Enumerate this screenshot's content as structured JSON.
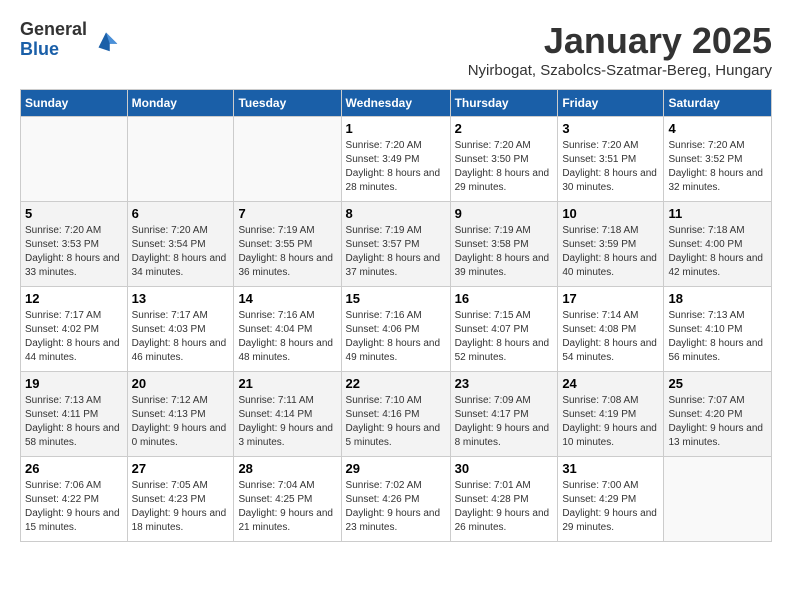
{
  "logo": {
    "general": "General",
    "blue": "Blue"
  },
  "title": "January 2025",
  "subtitle": "Nyirbogat, Szabolcs-Szatmar-Bereg, Hungary",
  "days_header": [
    "Sunday",
    "Monday",
    "Tuesday",
    "Wednesday",
    "Thursday",
    "Friday",
    "Saturday"
  ],
  "weeks": [
    [
      {
        "num": "",
        "info": ""
      },
      {
        "num": "",
        "info": ""
      },
      {
        "num": "",
        "info": ""
      },
      {
        "num": "1",
        "info": "Sunrise: 7:20 AM\nSunset: 3:49 PM\nDaylight: 8 hours and 28 minutes."
      },
      {
        "num": "2",
        "info": "Sunrise: 7:20 AM\nSunset: 3:50 PM\nDaylight: 8 hours and 29 minutes."
      },
      {
        "num": "3",
        "info": "Sunrise: 7:20 AM\nSunset: 3:51 PM\nDaylight: 8 hours and 30 minutes."
      },
      {
        "num": "4",
        "info": "Sunrise: 7:20 AM\nSunset: 3:52 PM\nDaylight: 8 hours and 32 minutes."
      }
    ],
    [
      {
        "num": "5",
        "info": "Sunrise: 7:20 AM\nSunset: 3:53 PM\nDaylight: 8 hours and 33 minutes."
      },
      {
        "num": "6",
        "info": "Sunrise: 7:20 AM\nSunset: 3:54 PM\nDaylight: 8 hours and 34 minutes."
      },
      {
        "num": "7",
        "info": "Sunrise: 7:19 AM\nSunset: 3:55 PM\nDaylight: 8 hours and 36 minutes."
      },
      {
        "num": "8",
        "info": "Sunrise: 7:19 AM\nSunset: 3:57 PM\nDaylight: 8 hours and 37 minutes."
      },
      {
        "num": "9",
        "info": "Sunrise: 7:19 AM\nSunset: 3:58 PM\nDaylight: 8 hours and 39 minutes."
      },
      {
        "num": "10",
        "info": "Sunrise: 7:18 AM\nSunset: 3:59 PM\nDaylight: 8 hours and 40 minutes."
      },
      {
        "num": "11",
        "info": "Sunrise: 7:18 AM\nSunset: 4:00 PM\nDaylight: 8 hours and 42 minutes."
      }
    ],
    [
      {
        "num": "12",
        "info": "Sunrise: 7:17 AM\nSunset: 4:02 PM\nDaylight: 8 hours and 44 minutes."
      },
      {
        "num": "13",
        "info": "Sunrise: 7:17 AM\nSunset: 4:03 PM\nDaylight: 8 hours and 46 minutes."
      },
      {
        "num": "14",
        "info": "Sunrise: 7:16 AM\nSunset: 4:04 PM\nDaylight: 8 hours and 48 minutes."
      },
      {
        "num": "15",
        "info": "Sunrise: 7:16 AM\nSunset: 4:06 PM\nDaylight: 8 hours and 49 minutes."
      },
      {
        "num": "16",
        "info": "Sunrise: 7:15 AM\nSunset: 4:07 PM\nDaylight: 8 hours and 52 minutes."
      },
      {
        "num": "17",
        "info": "Sunrise: 7:14 AM\nSunset: 4:08 PM\nDaylight: 8 hours and 54 minutes."
      },
      {
        "num": "18",
        "info": "Sunrise: 7:13 AM\nSunset: 4:10 PM\nDaylight: 8 hours and 56 minutes."
      }
    ],
    [
      {
        "num": "19",
        "info": "Sunrise: 7:13 AM\nSunset: 4:11 PM\nDaylight: 8 hours and 58 minutes."
      },
      {
        "num": "20",
        "info": "Sunrise: 7:12 AM\nSunset: 4:13 PM\nDaylight: 9 hours and 0 minutes."
      },
      {
        "num": "21",
        "info": "Sunrise: 7:11 AM\nSunset: 4:14 PM\nDaylight: 9 hours and 3 minutes."
      },
      {
        "num": "22",
        "info": "Sunrise: 7:10 AM\nSunset: 4:16 PM\nDaylight: 9 hours and 5 minutes."
      },
      {
        "num": "23",
        "info": "Sunrise: 7:09 AM\nSunset: 4:17 PM\nDaylight: 9 hours and 8 minutes."
      },
      {
        "num": "24",
        "info": "Sunrise: 7:08 AM\nSunset: 4:19 PM\nDaylight: 9 hours and 10 minutes."
      },
      {
        "num": "25",
        "info": "Sunrise: 7:07 AM\nSunset: 4:20 PM\nDaylight: 9 hours and 13 minutes."
      }
    ],
    [
      {
        "num": "26",
        "info": "Sunrise: 7:06 AM\nSunset: 4:22 PM\nDaylight: 9 hours and 15 minutes."
      },
      {
        "num": "27",
        "info": "Sunrise: 7:05 AM\nSunset: 4:23 PM\nDaylight: 9 hours and 18 minutes."
      },
      {
        "num": "28",
        "info": "Sunrise: 7:04 AM\nSunset: 4:25 PM\nDaylight: 9 hours and 21 minutes."
      },
      {
        "num": "29",
        "info": "Sunrise: 7:02 AM\nSunset: 4:26 PM\nDaylight: 9 hours and 23 minutes."
      },
      {
        "num": "30",
        "info": "Sunrise: 7:01 AM\nSunset: 4:28 PM\nDaylight: 9 hours and 26 minutes."
      },
      {
        "num": "31",
        "info": "Sunrise: 7:00 AM\nSunset: 4:29 PM\nDaylight: 9 hours and 29 minutes."
      },
      {
        "num": "",
        "info": ""
      }
    ]
  ]
}
